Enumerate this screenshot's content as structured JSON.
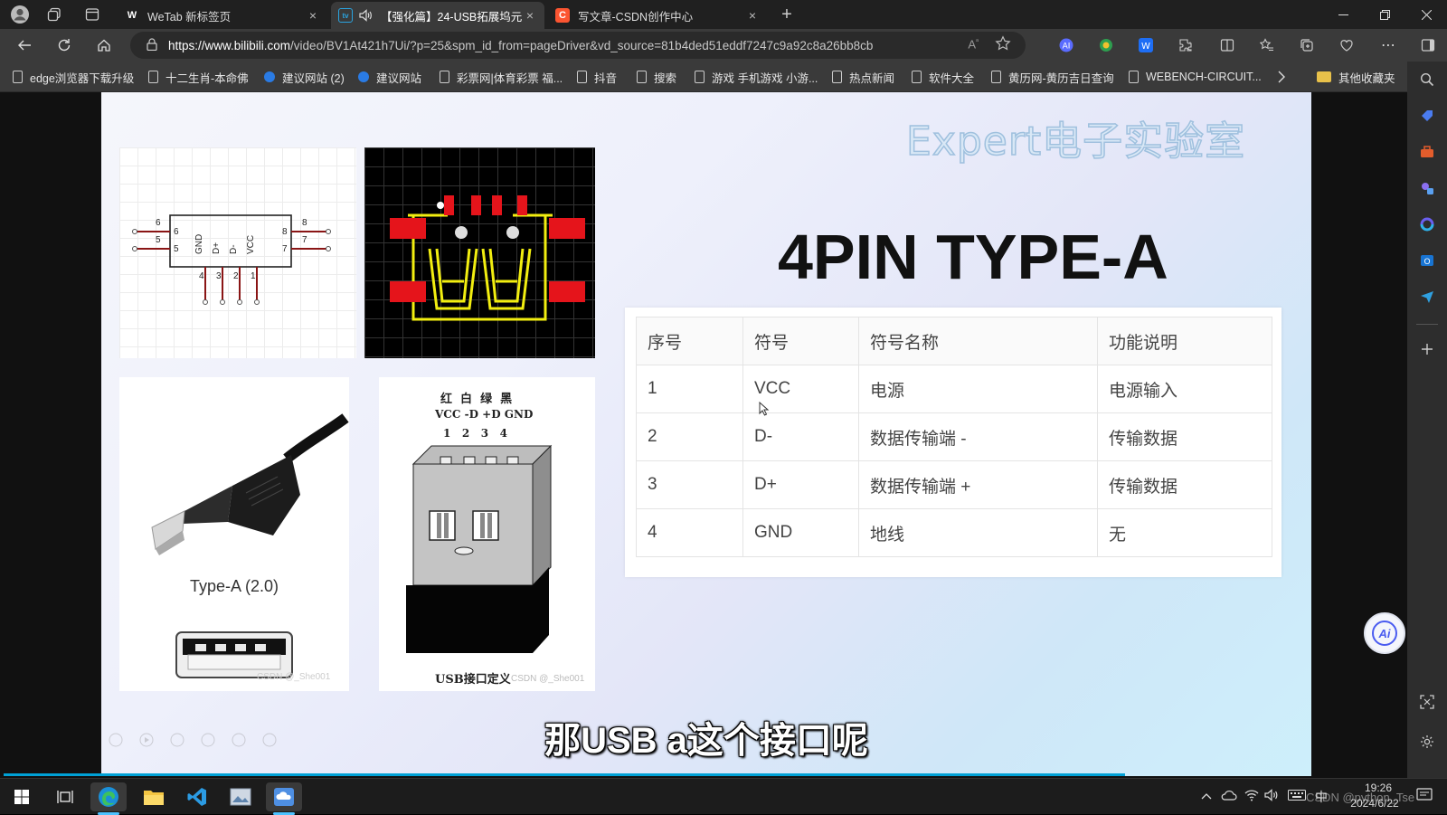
{
  "browser": {
    "tabs": [
      {
        "label": "WeTab 新标签页",
        "icon": "wetab-icon",
        "close": "×",
        "active": false
      },
      {
        "label": "【强化篇】24-USB拓展坞元",
        "icon": "bilibili-icon",
        "close": "×",
        "active": true
      },
      {
        "label": "写文章-CSDN创作中心",
        "icon": "csdn-icon",
        "close": "×",
        "active": false
      }
    ],
    "new_tab": "+",
    "url_host": "https://www.bilibili.com",
    "url_path": "/video/BV1At421h7Ui/?p=25&spm_id_from=pageDriver&vd_source=81b4ded51eddf7247c9a92c8a26bb8cb",
    "bookmarks": [
      "edge浏览器下载升级",
      "十二生肖-本命佛",
      "建议网站 (2)",
      "建议网站",
      "彩票网|体育彩票 福...",
      "抖音",
      "搜索",
      "游戏 手机游戏 小游...",
      "热点新闻",
      "软件大全",
      "黄历网-黄历吉日查询",
      "WEBENCH-CIRCUIT..."
    ],
    "other_bookmarks": "其他收藏夹"
  },
  "slide": {
    "watermark": "Expert电子实验室",
    "title": "4PIN TYPE-A",
    "table": {
      "headers": [
        "序号",
        "符号",
        "符号名称",
        "功能说明"
      ],
      "rows": [
        [
          "1",
          "VCC",
          "电源",
          "电源输入"
        ],
        [
          "2",
          "D-",
          "数据传输端 -",
          "传输数据"
        ],
        [
          "3",
          "D+",
          "数据传输端 +",
          "传输数据"
        ],
        [
          "4",
          "GND",
          "地线",
          "无"
        ]
      ]
    },
    "schematic_pins": {
      "left": [
        "6",
        "5"
      ],
      "right": [
        "8",
        "7"
      ],
      "bottom": [
        "4",
        "3",
        "2",
        "1"
      ],
      "signals": [
        "GND",
        "D+",
        "D-",
        "VCC"
      ]
    },
    "photo_caption": "Type-A (2.0)",
    "photo_watermark": "CSDN @_She001",
    "diagram": {
      "colors": "红  白  绿  黑",
      "signals": "VCC -D +D GND",
      "numbers": "1   2   3   4",
      "caption": "USB接口定义",
      "watermark": "CSDN @_She001"
    },
    "subtitle": "那USB a这个接口呢"
  },
  "ai_button": "Ai",
  "taskbar": {
    "ime": "中",
    "time": "19:26",
    "date": "2024/6/22",
    "overlay": "CSDN @python_Tse"
  },
  "colors": {
    "accent": "#00a1d6",
    "pcb_pad": "#e5141b",
    "pcb_outline": "#f2ee10"
  }
}
